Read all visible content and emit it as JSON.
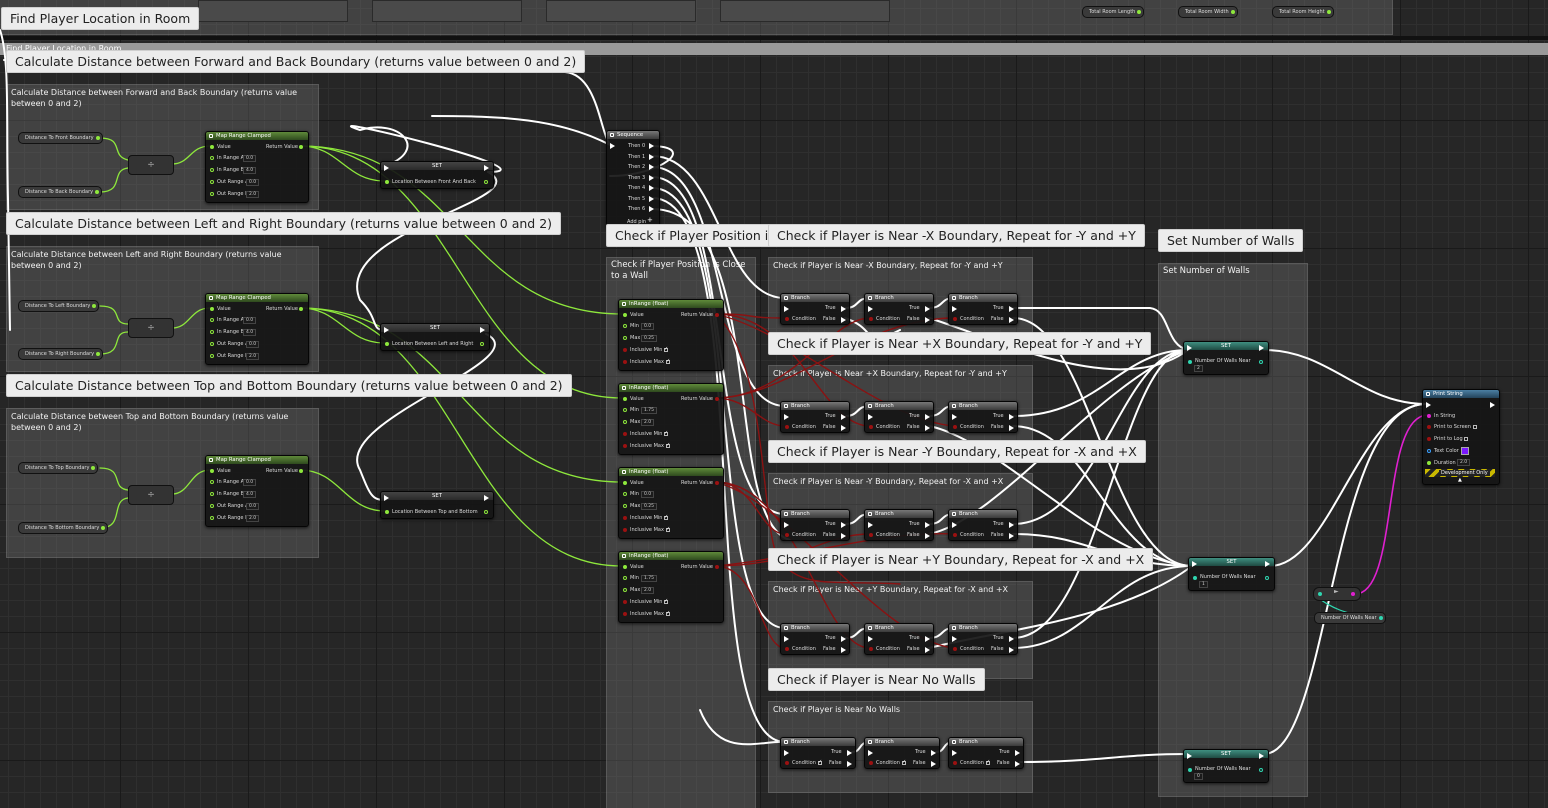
{
  "graph_title": "Find Player Location in Room",
  "section_title": "Find Player Location in Room",
  "comments": {
    "calc_fb": "Calculate Distance between Forward and Back Boundary (returns value between 0 and 2)",
    "calc_lr": "Calculate Distance between Left and Right Boundary (returns value between 0 and 2)",
    "calc_tb": "Calculate Distance between Top and Bottom Boundary (returns value between 0 and 2)",
    "check_close": "Check if Player Position is Close to a Wall",
    "near_negx": "Check if Player is Near -X Boundary, Repeat for -Y and +Y",
    "near_posx": "Check if Player is Near +X Boundary, Repeat for -Y and +Y",
    "near_negy": "Check if Player is Near -Y Boundary, Repeat for -X and +X",
    "near_posy": "Check if Player is Near +Y Boundary, Repeat for -X and +X",
    "near_none": "Check if Player is Near No Walls",
    "set_walls": "Set Number of Walls"
  },
  "top_getters": [
    "Total Room Length",
    "Total Room Width",
    "Total Room Height"
  ],
  "getters": {
    "front": "Distance To Front Boundary",
    "back": "Distance To Back Boundary",
    "left": "Distance To Left Boundary",
    "right": "Distance To Right Boundary",
    "top": "Distance To Top Boundary",
    "bottom": "Distance To Bottom Boundary",
    "walls": "Number Of Walls Near"
  },
  "divide_symbol": "÷",
  "multiply_symbol": "×",
  "map_range": {
    "title": "Map Range Clamped",
    "value": "Value",
    "return": "Return Value",
    "in_a": "In Range A",
    "in_a_val": "0.0",
    "in_b": "In Range B",
    "in_b_val": "4.0",
    "out_a": "Out Range A",
    "out_a_val": "0.0",
    "out_b": "Out Range B",
    "out_b_val": "2.0"
  },
  "set_title": "SET",
  "set_vars": {
    "fb": "Location Between Front And Back",
    "lr": "Location Between Left and Right",
    "tb": "Location Between Top and Bottom",
    "walls": "Number Of Walls Near"
  },
  "wall_values": [
    "2",
    "1",
    "0"
  ],
  "sequence": {
    "title": "Sequence",
    "outputs": [
      "Then 0",
      "Then 1",
      "Then 2",
      "Then 3",
      "Then 4",
      "Then 5",
      "Then 6"
    ],
    "add_pin": "Add pin"
  },
  "inrange": {
    "title": "InRange (float)",
    "value": "Value",
    "return": "Return Value",
    "min": "Min",
    "max": "Max",
    "incl_min": "Inclusive Min",
    "incl_max": "Inclusive Max",
    "nodes": [
      {
        "min": "0.0",
        "max": "0.25"
      },
      {
        "min": "1.75",
        "max": "2.0"
      },
      {
        "min": "0.0",
        "max": "0.25"
      },
      {
        "min": "1.75",
        "max": "2.0"
      }
    ]
  },
  "branch": {
    "title": "Branch",
    "condition": "Condition",
    "true": "True",
    "false": "False"
  },
  "print_string": {
    "title": "Print String",
    "in_string": "In String",
    "to_screen": "Print to Screen",
    "to_log": "Print to Log",
    "text_color": "Text Color",
    "duration": "Duration",
    "duration_val": "2.0",
    "dev_only": "Development Only"
  },
  "colors": {
    "float_pin": "#8ee83c",
    "int_pin": "#2fd6b0",
    "bool_pin": "#9b1111",
    "string_pin": "#e020d0",
    "exec_wire": "#ffffff",
    "text_color_swatch": "#7a18ff"
  }
}
